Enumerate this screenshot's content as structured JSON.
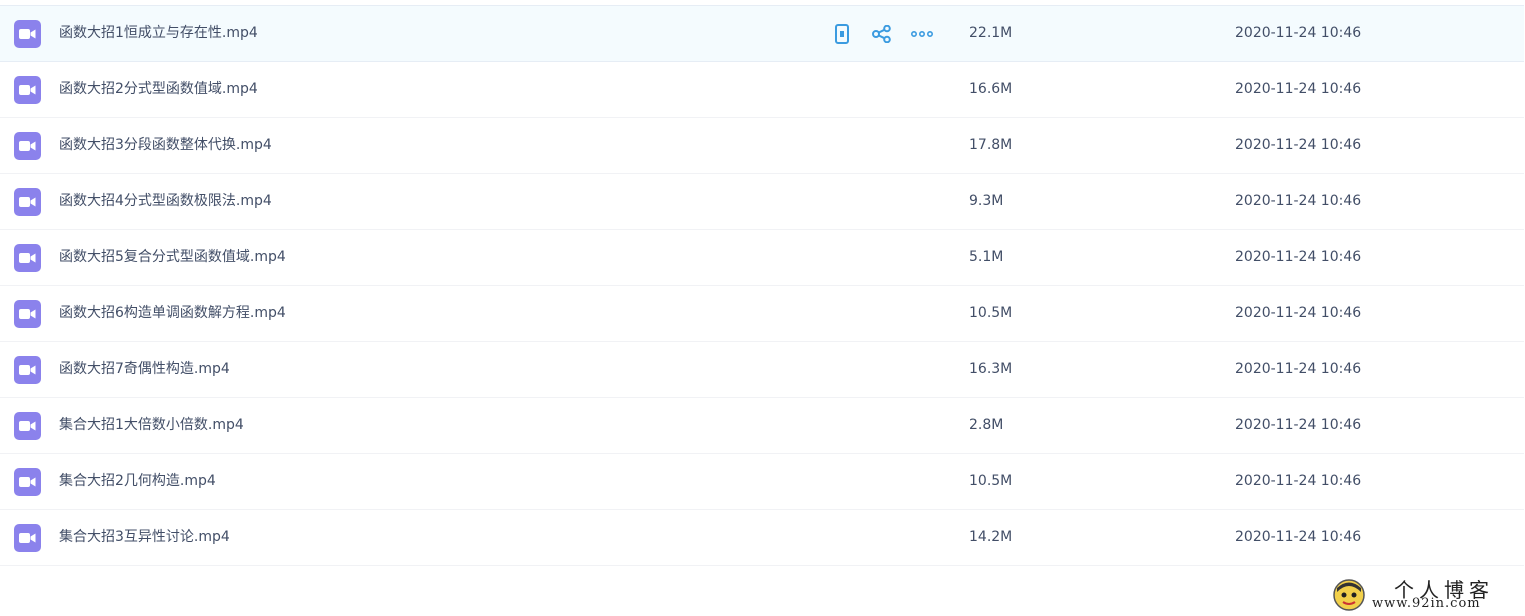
{
  "files": [
    {
      "name": "函数大招1恒成立与存在性.mp4",
      "size": "22.1M",
      "modified": "2020-11-24 10:46",
      "hovered": true
    },
    {
      "name": "函数大招2分式型函数值域.mp4",
      "size": "16.6M",
      "modified": "2020-11-24 10:46",
      "hovered": false
    },
    {
      "name": "函数大招3分段函数整体代换.mp4",
      "size": "17.8M",
      "modified": "2020-11-24 10:46",
      "hovered": false
    },
    {
      "name": "函数大招4分式型函数极限法.mp4",
      "size": "9.3M",
      "modified": "2020-11-24 10:46",
      "hovered": false
    },
    {
      "name": "函数大招5复合分式型函数值域.mp4",
      "size": "5.1M",
      "modified": "2020-11-24 10:46",
      "hovered": false
    },
    {
      "name": "函数大招6构造单调函数解方程.mp4",
      "size": "10.5M",
      "modified": "2020-11-24 10:46",
      "hovered": false
    },
    {
      "name": "函数大招7奇偶性构造.mp4",
      "size": "16.3M",
      "modified": "2020-11-24 10:46",
      "hovered": false
    },
    {
      "name": "集合大招1大倍数小倍数.mp4",
      "size": "2.8M",
      "modified": "2020-11-24 10:46",
      "hovered": false
    },
    {
      "name": "集合大招2几何构造.mp4",
      "size": "10.5M",
      "modified": "2020-11-24 10:46",
      "hovered": false
    },
    {
      "name": "集合大招3互异性讨论.mp4",
      "size": "14.2M",
      "modified": "2020-11-24 10:46",
      "hovered": false
    }
  ],
  "row_actions": [
    {
      "icon": "phone-icon"
    },
    {
      "icon": "share-icon"
    },
    {
      "icon": "more-icon"
    }
  ],
  "file_icon": "video-file-icon",
  "watermark": {
    "title": "个人博客",
    "url": "www.92in.com"
  },
  "colors": {
    "file_icon_bg": "#8b82ec",
    "action_icon": "#3b9be0",
    "hover_row_bg": "#f4fbfe",
    "text": "#424e67"
  }
}
